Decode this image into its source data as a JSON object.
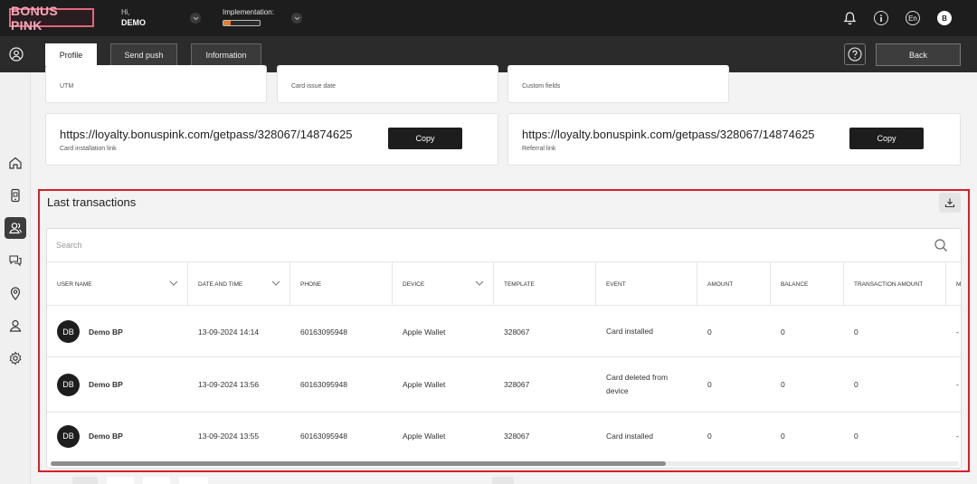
{
  "app": {
    "logo_text": "BONUS PINK",
    "greeting": "Hi,",
    "user_name": "DEMO",
    "implementation_label": "Implementation:",
    "implementation_progress": 0.2,
    "language": "En",
    "avatar_letter": "B"
  },
  "actions": {
    "profile": "Profile",
    "send_push": "Send push",
    "information": "Information",
    "back": "Back"
  },
  "info_cards": [
    {
      "label": "UTM"
    },
    {
      "label": "Card issue date"
    },
    {
      "label": "Custom fields"
    }
  ],
  "link_cards": [
    {
      "url": "https://loyalty.bonuspink.com/getpass/328067/14874625",
      "label": "Card installation link",
      "button": "Copy"
    },
    {
      "url": "https://loyalty.bonuspink.com/getpass/328067/14874625",
      "label": "Referral link",
      "button": "Copy"
    }
  ],
  "transactions": {
    "title": "Last transactions",
    "search_placeholder": "Search",
    "columns": [
      "USER NAME",
      "DATE AND TIME",
      "PHONE",
      "DEVICE",
      "TEMPLATE",
      "EVENT",
      "AMOUNT",
      "BALANCE",
      "TRANSACTION AMOUNT",
      "M"
    ],
    "rows": [
      {
        "initials": "DB",
        "user": "Demo BP",
        "datetime": "13-09-2024 14:14",
        "phone": "60163095948",
        "device": "Apple Wallet",
        "template": "328067",
        "event": "Card installed",
        "amount": "0",
        "balance": "0",
        "transaction_amount": "0",
        "extra": "-"
      },
      {
        "initials": "DB",
        "user": "Demo BP",
        "datetime": "13-09-2024 13:56",
        "phone": "60163095948",
        "device": "Apple Wallet",
        "template": "328067",
        "event": "Card deleted from device",
        "amount": "0",
        "balance": "0",
        "transaction_amount": "0",
        "extra": "-"
      },
      {
        "initials": "DB",
        "user": "Demo BP",
        "datetime": "13-09-2024 13:55",
        "phone": "60163095948",
        "device": "Apple Wallet",
        "template": "328067",
        "event": "Card installed",
        "amount": "0",
        "balance": "0",
        "transaction_amount": "0",
        "extra": "-"
      }
    ]
  },
  "icons": {
    "top": [
      "bell-icon",
      "info-icon",
      "language-icon",
      "avatar"
    ],
    "sidebar": [
      "home-icon",
      "mobile-card-icon",
      "users-icon",
      "chat-icon",
      "location-icon",
      "user-icon",
      "gear-icon"
    ]
  },
  "colors": {
    "brand_pink": "#e1667d",
    "progress_orange": "#e87b2c",
    "highlight_red": "#d5202a",
    "dark": "#1d1d1d"
  }
}
